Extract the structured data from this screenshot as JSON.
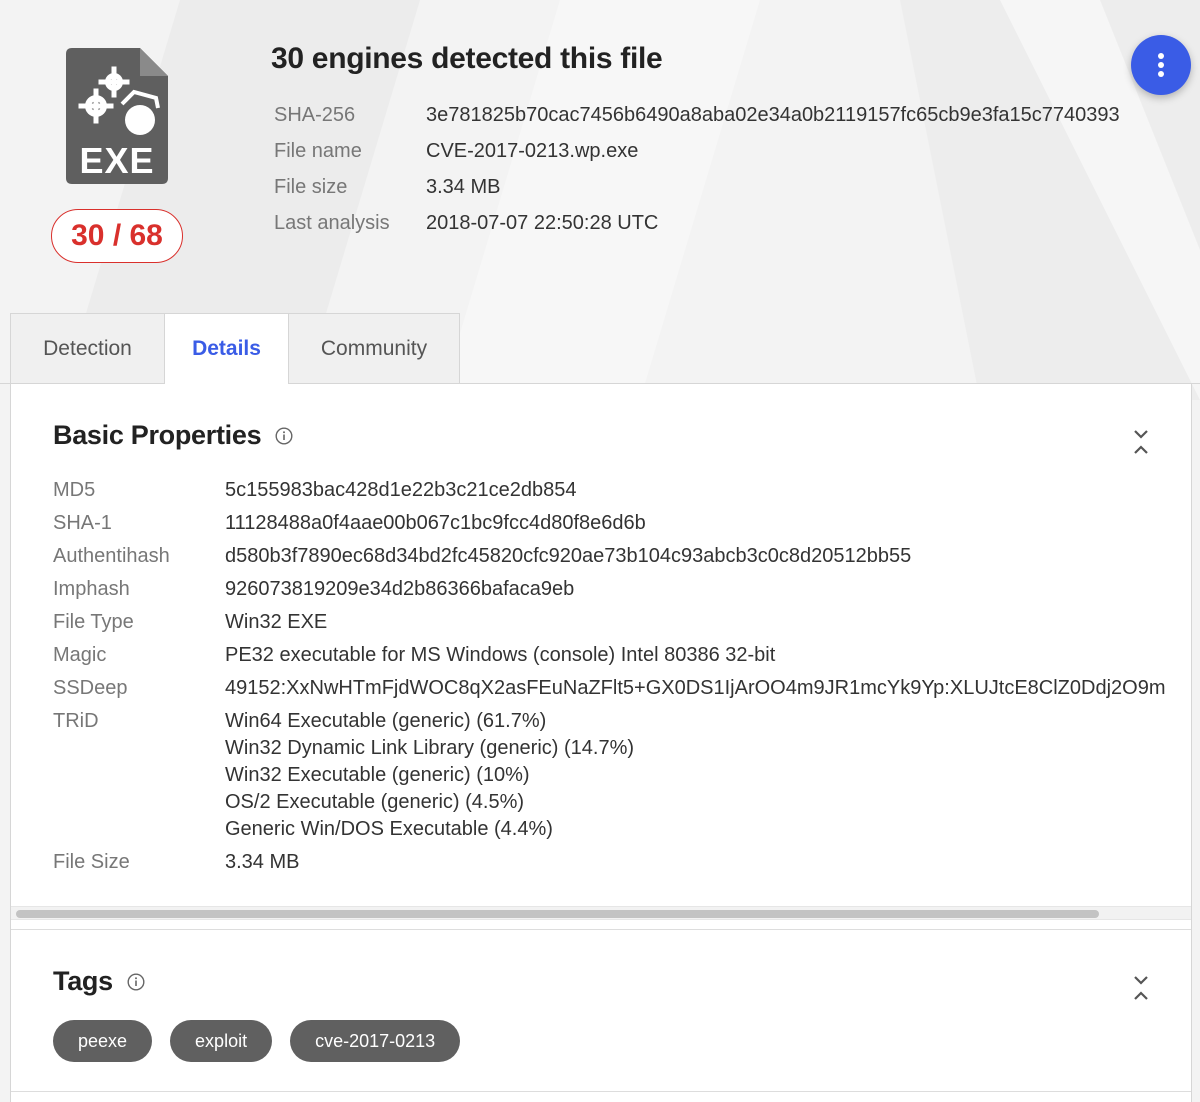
{
  "file_icon": {
    "label": "EXE"
  },
  "score": {
    "text": "30 / 68"
  },
  "header": {
    "title": "30 engines detected this file",
    "meta": [
      {
        "label": "SHA-256",
        "value": "3e781825b70cac7456b6490a8aba02e34a0b2119157fc65cb9e3fa15c7740393"
      },
      {
        "label": "File name",
        "value": "CVE-2017-0213.wp.exe"
      },
      {
        "label": "File size",
        "value": "3.34 MB"
      },
      {
        "label": "Last analysis",
        "value": "2018-07-07 22:50:28 UTC"
      }
    ]
  },
  "tabs": [
    {
      "label": "Detection",
      "active": false
    },
    {
      "label": "Details",
      "active": true
    },
    {
      "label": "Community",
      "active": false
    }
  ],
  "basic_properties": {
    "title": "Basic Properties",
    "rows": [
      {
        "label": "MD5",
        "value": "5c155983bac428d1e22b3c21ce2db854"
      },
      {
        "label": "SHA-1",
        "value": "11128488a0f4aae00b067c1bc9fcc4d80f8e6d6b"
      },
      {
        "label": "Authentihash",
        "value": "d580b3f7890ec68d34bd2fc45820cfc920ae73b104c93abcb3c0c8d20512bb55"
      },
      {
        "label": "Imphash",
        "value": "926073819209e34d2b86366bafaca9eb"
      },
      {
        "label": "File Type",
        "value": "Win32 EXE"
      },
      {
        "label": "Magic",
        "value": "PE32 executable for MS Windows (console) Intel 80386 32-bit"
      },
      {
        "label": "SSDeep",
        "value": "49152:XxNwHTmFjdWOC8qX2asFEuNaZFlt5+GX0DS1IjArOO4m9JR1mcYk9Yp:XLUJtcE8ClZ0Ddj2O9m"
      }
    ],
    "trid": {
      "label": "TRiD",
      "values": [
        "Win64 Executable (generic) (61.7%)",
        "Win32 Dynamic Link Library (generic) (14.7%)",
        "Win32 Executable (generic) (10%)",
        "OS/2 Executable (generic) (4.5%)",
        "Generic Win/DOS Executable (4.4%)"
      ]
    },
    "file_size": {
      "label": "File Size",
      "value": "3.34 MB"
    }
  },
  "tags_section": {
    "title": "Tags",
    "tags": [
      "peexe",
      "exploit",
      "cve-2017-0213"
    ]
  },
  "colors": {
    "accent": "#3a5ce6",
    "danger": "#d9302c",
    "tag_bg": "#606060"
  }
}
